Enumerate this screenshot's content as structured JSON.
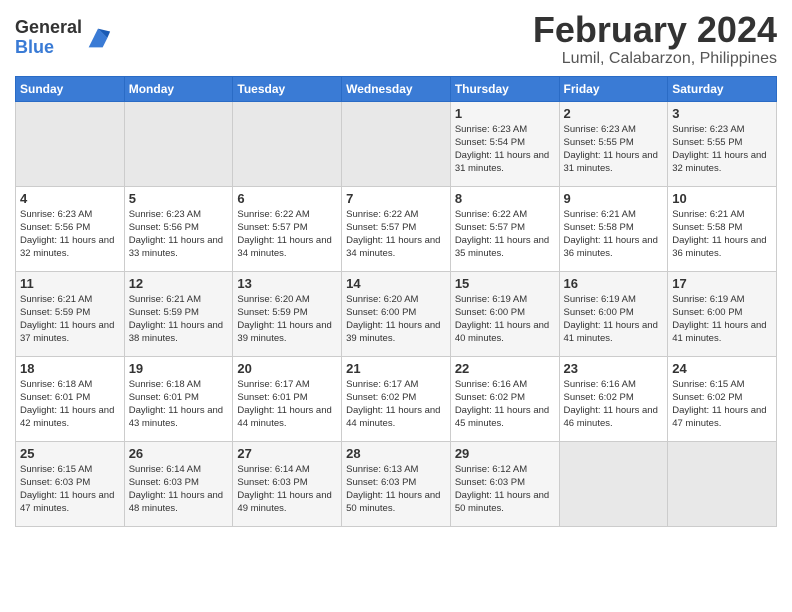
{
  "logo": {
    "general": "General",
    "blue": "Blue"
  },
  "header": {
    "month": "February 2024",
    "location": "Lumil, Calabarzon, Philippines"
  },
  "weekdays": [
    "Sunday",
    "Monday",
    "Tuesday",
    "Wednesday",
    "Thursday",
    "Friday",
    "Saturday"
  ],
  "weeks": [
    [
      {
        "day": "",
        "empty": true
      },
      {
        "day": "",
        "empty": true
      },
      {
        "day": "",
        "empty": true
      },
      {
        "day": "",
        "empty": true
      },
      {
        "day": "1",
        "sunrise": "6:23 AM",
        "sunset": "5:54 PM",
        "daylight": "11 hours and 31 minutes."
      },
      {
        "day": "2",
        "sunrise": "6:23 AM",
        "sunset": "5:55 PM",
        "daylight": "11 hours and 31 minutes."
      },
      {
        "day": "3",
        "sunrise": "6:23 AM",
        "sunset": "5:55 PM",
        "daylight": "11 hours and 32 minutes."
      }
    ],
    [
      {
        "day": "4",
        "sunrise": "6:23 AM",
        "sunset": "5:56 PM",
        "daylight": "11 hours and 32 minutes."
      },
      {
        "day": "5",
        "sunrise": "6:23 AM",
        "sunset": "5:56 PM",
        "daylight": "11 hours and 33 minutes."
      },
      {
        "day": "6",
        "sunrise": "6:22 AM",
        "sunset": "5:57 PM",
        "daylight": "11 hours and 34 minutes."
      },
      {
        "day": "7",
        "sunrise": "6:22 AM",
        "sunset": "5:57 PM",
        "daylight": "11 hours and 34 minutes."
      },
      {
        "day": "8",
        "sunrise": "6:22 AM",
        "sunset": "5:57 PM",
        "daylight": "11 hours and 35 minutes."
      },
      {
        "day": "9",
        "sunrise": "6:21 AM",
        "sunset": "5:58 PM",
        "daylight": "11 hours and 36 minutes."
      },
      {
        "day": "10",
        "sunrise": "6:21 AM",
        "sunset": "5:58 PM",
        "daylight": "11 hours and 36 minutes."
      }
    ],
    [
      {
        "day": "11",
        "sunrise": "6:21 AM",
        "sunset": "5:59 PM",
        "daylight": "11 hours and 37 minutes."
      },
      {
        "day": "12",
        "sunrise": "6:21 AM",
        "sunset": "5:59 PM",
        "daylight": "11 hours and 38 minutes."
      },
      {
        "day": "13",
        "sunrise": "6:20 AM",
        "sunset": "5:59 PM",
        "daylight": "11 hours and 39 minutes."
      },
      {
        "day": "14",
        "sunrise": "6:20 AM",
        "sunset": "6:00 PM",
        "daylight": "11 hours and 39 minutes."
      },
      {
        "day": "15",
        "sunrise": "6:19 AM",
        "sunset": "6:00 PM",
        "daylight": "11 hours and 40 minutes."
      },
      {
        "day": "16",
        "sunrise": "6:19 AM",
        "sunset": "6:00 PM",
        "daylight": "11 hours and 41 minutes."
      },
      {
        "day": "17",
        "sunrise": "6:19 AM",
        "sunset": "6:00 PM",
        "daylight": "11 hours and 41 minutes."
      }
    ],
    [
      {
        "day": "18",
        "sunrise": "6:18 AM",
        "sunset": "6:01 PM",
        "daylight": "11 hours and 42 minutes."
      },
      {
        "day": "19",
        "sunrise": "6:18 AM",
        "sunset": "6:01 PM",
        "daylight": "11 hours and 43 minutes."
      },
      {
        "day": "20",
        "sunrise": "6:17 AM",
        "sunset": "6:01 PM",
        "daylight": "11 hours and 44 minutes."
      },
      {
        "day": "21",
        "sunrise": "6:17 AM",
        "sunset": "6:02 PM",
        "daylight": "11 hours and 44 minutes."
      },
      {
        "day": "22",
        "sunrise": "6:16 AM",
        "sunset": "6:02 PM",
        "daylight": "11 hours and 45 minutes."
      },
      {
        "day": "23",
        "sunrise": "6:16 AM",
        "sunset": "6:02 PM",
        "daylight": "11 hours and 46 minutes."
      },
      {
        "day": "24",
        "sunrise": "6:15 AM",
        "sunset": "6:02 PM",
        "daylight": "11 hours and 47 minutes."
      }
    ],
    [
      {
        "day": "25",
        "sunrise": "6:15 AM",
        "sunset": "6:03 PM",
        "daylight": "11 hours and 47 minutes."
      },
      {
        "day": "26",
        "sunrise": "6:14 AM",
        "sunset": "6:03 PM",
        "daylight": "11 hours and 48 minutes."
      },
      {
        "day": "27",
        "sunrise": "6:14 AM",
        "sunset": "6:03 PM",
        "daylight": "11 hours and 49 minutes."
      },
      {
        "day": "28",
        "sunrise": "6:13 AM",
        "sunset": "6:03 PM",
        "daylight": "11 hours and 50 minutes."
      },
      {
        "day": "29",
        "sunrise": "6:12 AM",
        "sunset": "6:03 PM",
        "daylight": "11 hours and 50 minutes."
      },
      {
        "day": "",
        "empty": true
      },
      {
        "day": "",
        "empty": true
      }
    ]
  ]
}
